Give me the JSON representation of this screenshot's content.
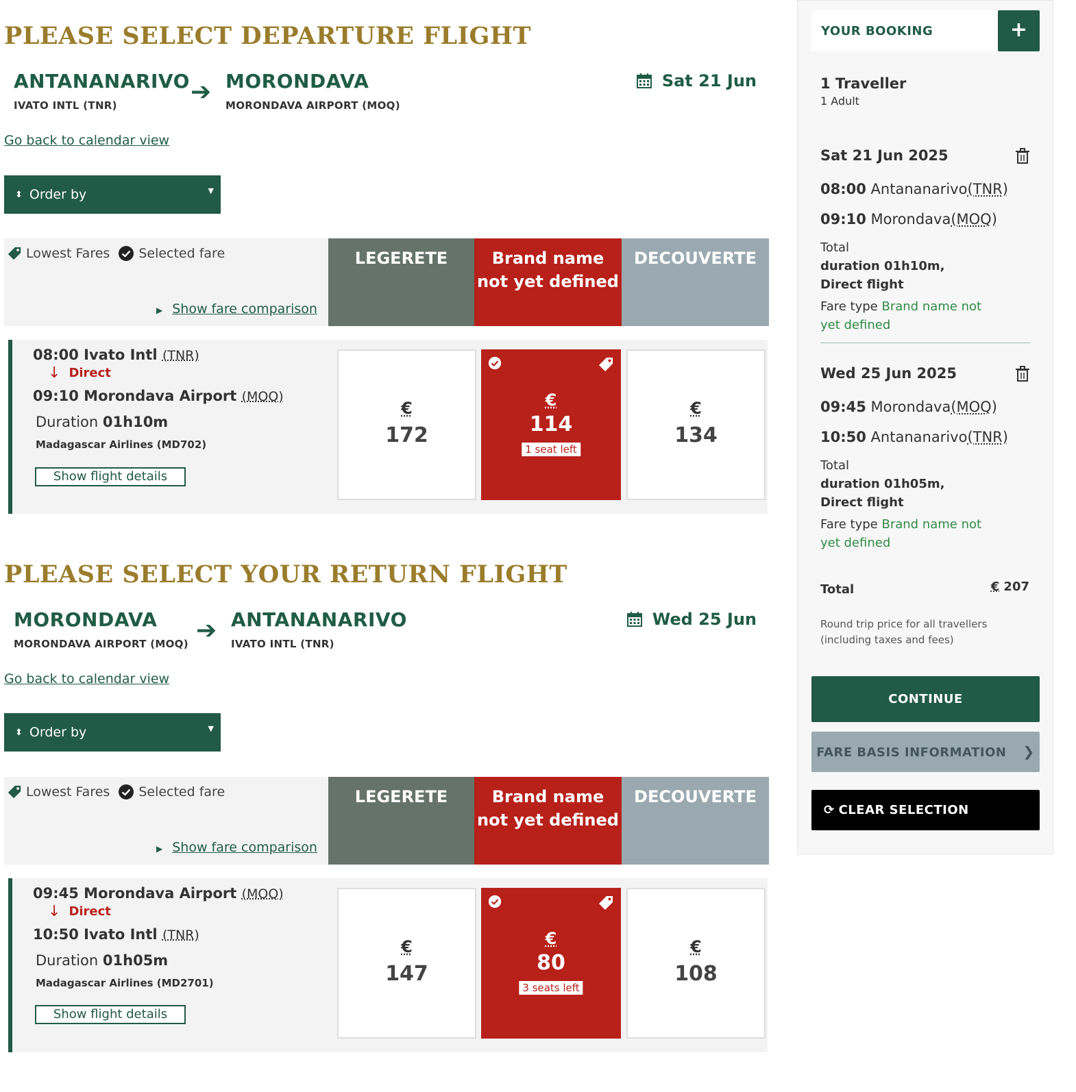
{
  "departure": {
    "title": "PLEASE SELECT DEPARTURE FLIGHT",
    "origin_city": "ANTANANARIVO",
    "origin_airport": "IVATO INTL (TNR)",
    "dest_city": "MORONDAVA",
    "dest_airport": "MORONDAVA AIRPORT (MOQ)",
    "date": "Sat 21 Jun",
    "back_link": "Go back to calendar view",
    "order_by": "Order by",
    "legend_lowest": "Lowest Fares",
    "legend_selected": "Selected fare",
    "fare_comparison": "Show fare comparison",
    "col_leg": "LEGERETE",
    "col_brand": "Brand name not yet defined",
    "col_dec": "DECOUVERTE",
    "flight": {
      "dep_time": "08:00",
      "dep_airport": "Ivato Intl",
      "dep_code": "(TNR)",
      "direct": "Direct",
      "arr_time": "09:10",
      "arr_airport": "Morondava Airport",
      "arr_code": "(MOQ)",
      "duration_label": "Duration",
      "duration": "01h10m",
      "airline": "Madagascar Airlines (MD702)",
      "details_btn": "Show flight details",
      "price_leg": "172",
      "price_brand": "114",
      "seats_left": "1 seat left",
      "price_dec": "134",
      "currency": "€"
    }
  },
  "return": {
    "title": "PLEASE SELECT YOUR RETURN FLIGHT",
    "origin_city": "MORONDAVA",
    "origin_airport": "MORONDAVA AIRPORT (MOQ)",
    "dest_city": "ANTANANARIVO",
    "dest_airport": "IVATO INTL (TNR)",
    "date": "Wed 25 Jun",
    "back_link": "Go back to calendar view",
    "order_by": "Order by",
    "legend_lowest": "Lowest Fares",
    "legend_selected": "Selected fare",
    "fare_comparison": "Show fare comparison",
    "col_leg": "LEGERETE",
    "col_brand": "Brand name not yet defined",
    "col_dec": "DECOUVERTE",
    "flight": {
      "dep_time": "09:45",
      "dep_airport": "Morondava Airport",
      "dep_code": "(MOQ)",
      "direct": "Direct",
      "arr_time": "10:50",
      "arr_airport": "Ivato Intl",
      "arr_code": "(TNR)",
      "duration_label": "Duration",
      "duration": "01h05m",
      "airline": "Madagascar Airlines (MD2701)",
      "details_btn": "Show flight details",
      "price_leg": "147",
      "price_brand": "80",
      "seats_left": "3 seats left",
      "price_dec": "108",
      "currency": "€"
    }
  },
  "sidebar": {
    "heading": "YOUR BOOKING",
    "plus": "+",
    "travellers": "1 Traveller",
    "travellers_detail": "1 Adult",
    "outbound": {
      "date": "Sat 21 Jun 2025",
      "dep_time": "08:00",
      "dep_city": "Antananarivo",
      "dep_code": "(TNR)",
      "arr_time": "09:10",
      "arr_city": "Morondava",
      "arr_code": "(MOQ)",
      "duration_prefix": "Total",
      "duration_bold": "duration 01h10m, Direct flight",
      "fare_type_label": "Fare type",
      "fare_type": "Brand name not yet defined"
    },
    "inbound": {
      "date": "Wed 25 Jun 2025",
      "dep_time": "09:45",
      "dep_city": "Morondava",
      "dep_code": "(MOQ)",
      "arr_time": "10:50",
      "arr_city": "Antananarivo",
      "arr_code": "(TNR)",
      "duration_prefix": "Total",
      "duration_bold": "duration 01h05m, Direct flight",
      "fare_type_label": "Fare type",
      "fare_type": "Brand name not yet defined"
    },
    "total_label": "Total",
    "total_currency": "€",
    "total_value": "207",
    "total_note": "Round trip price for all travellers (including taxes and fees)",
    "continue": "CONTINUE",
    "fare_basis": "FARE BASIS INFORMATION",
    "clear": "CLEAR SELECTION"
  },
  "colors": {
    "brand_green": "#215a46",
    "title_gold": "#9a7c2b",
    "selected_red": "#b8201a",
    "legerete_gray": "#65736b",
    "decouverte_gray": "#9aa9b0"
  },
  "icons": [
    "calendar-icon",
    "arrow-right-icon",
    "sort-icon",
    "caret-down-icon",
    "tag-icon",
    "check-circle-icon",
    "triangle-right-icon",
    "down-arrow-icon",
    "trash-icon",
    "plus-icon",
    "chevron-right-icon",
    "refresh-icon"
  ]
}
